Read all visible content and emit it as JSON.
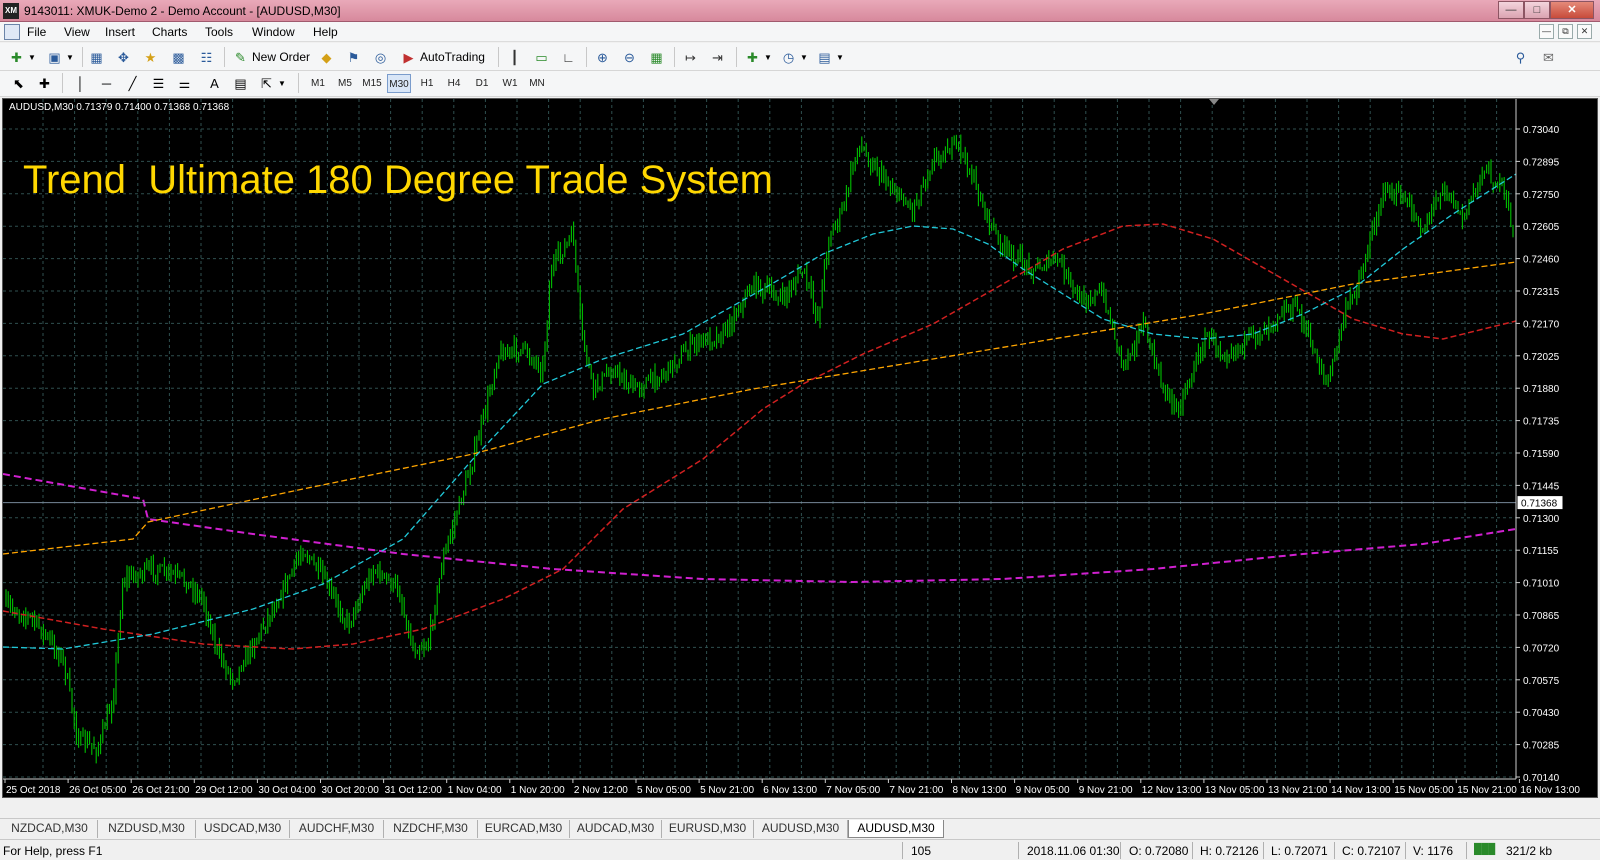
{
  "window": {
    "title": "9143011: XMUK-Demo 2 - Demo Account - [AUDUSD,M30]",
    "app_icon": "XM",
    "controls": [
      "minimize",
      "maximize",
      "close"
    ]
  },
  "menu": {
    "items": [
      "File",
      "View",
      "Insert",
      "Charts",
      "Tools",
      "Window",
      "Help"
    ]
  },
  "toolbar": {
    "new_order_label": "New Order",
    "autotrading_label": "AutoTrading",
    "timeframes": [
      "M1",
      "M5",
      "M15",
      "M30",
      "H1",
      "H4",
      "D1",
      "W1",
      "MN"
    ],
    "active_timeframe": "M30"
  },
  "chart": {
    "header": "AUDUSD,M30  0.71379 0.71400 0.71368 0.71368",
    "overlay_title": "Trend  Ultimate 180 Degree Trade System",
    "price_labels": [
      "0.73040",
      "0.72895",
      "0.72750",
      "0.72605",
      "0.72460",
      "0.72315",
      "0.72170",
      "0.72025",
      "0.71880",
      "0.71735",
      "0.71590",
      "0.71445",
      "0.71300",
      "0.71155",
      "0.71010",
      "0.70865",
      "0.70720",
      "0.70575",
      "0.70430",
      "0.70285",
      "0.70140"
    ],
    "current_price": "0.71368",
    "time_labels": [
      "25 Oct 2018",
      "26 Oct 05:00",
      "26 Oct 21:00",
      "29 Oct 12:00",
      "30 Oct 04:00",
      "30 Oct 20:00",
      "31 Oct 12:00",
      "1 Nov 04:00",
      "1 Nov 20:00",
      "2 Nov 12:00",
      "5 Nov 05:00",
      "5 Nov 21:00",
      "6 Nov 13:00",
      "7 Nov 05:00",
      "7 Nov 21:00",
      "8 Nov 13:00",
      "9 Nov 05:00",
      "9 Nov 21:00",
      "12 Nov 13:00",
      "13 Nov 05:00",
      "13 Nov 21:00",
      "14 Nov 13:00",
      "15 Nov 05:00",
      "15 Nov 21:00",
      "16 Nov 13:00"
    ],
    "colors": {
      "background": "#000000",
      "grid": "#2f4f4f",
      "candles": "#00c000",
      "ma_fast": "#20c8d8",
      "ma_mid": "#d02020",
      "ma_slow": "#ffa500",
      "ma_long": "#d020d0",
      "title": "#ffd700",
      "axis_text": "#ffffff"
    }
  },
  "tabs": {
    "items": [
      "NZDCAD,M30",
      "NZDUSD,M30",
      "USDCAD,M30",
      "AUDCHF,M30",
      "NZDCHF,M30",
      "EURCAD,M30",
      "AUDCAD,M30",
      "EURUSD,M30",
      "AUDUSD,M30",
      "AUDUSD,M30"
    ],
    "active_index": 9
  },
  "status": {
    "help": "For Help, press F1",
    "bars": "105",
    "datetime": "2018.11.06 01:30",
    "open": "O: 0.72080",
    "high": "H: 0.72126",
    "low": "L: 0.72071",
    "close": "C: 0.72107",
    "volume": "V: 1176",
    "traffic": "321/2 kb"
  }
}
